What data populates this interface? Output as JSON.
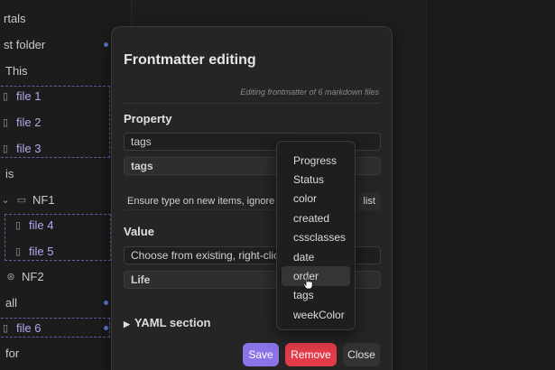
{
  "sidebar": {
    "rows": [
      {
        "label": "rtals",
        "type": "folder",
        "dot": false
      },
      {
        "label": "st folder",
        "type": "folder",
        "dot": true
      },
      {
        "label": "This",
        "type": "text",
        "dot": false
      },
      {
        "label": "file 1",
        "type": "file",
        "dot": false
      },
      {
        "label": "file 2",
        "type": "file",
        "dot": false
      },
      {
        "label": "file 3",
        "type": "file",
        "dot": false
      },
      {
        "label": "is",
        "type": "text",
        "dot": false
      },
      {
        "label": "NF1",
        "type": "folder",
        "dot": false
      },
      {
        "label": "file 4",
        "type": "file",
        "dot": false
      },
      {
        "label": "file 5",
        "type": "file",
        "dot": false
      },
      {
        "label": "NF2",
        "type": "folder",
        "dot": false
      },
      {
        "label": "all",
        "type": "text",
        "dot": true
      },
      {
        "label": "file 6",
        "type": "file",
        "dot": true
      },
      {
        "label": "for",
        "type": "text",
        "dot": false
      }
    ]
  },
  "modal": {
    "title": "Frontmatter editing",
    "subtitle": "Editing frontmatter of 6 markdown files",
    "property_heading": "Property",
    "property_input_value": "tags",
    "property_selected": "tags",
    "hint_text": "Ensure type on new items, ignore c",
    "hint_button": "list",
    "value_heading": "Value",
    "value_placeholder": "Choose from existing, right-clic",
    "value_current": "Life",
    "yaml_section": "YAML section",
    "save_label": "Save",
    "remove_label": "Remove",
    "close_label": "Close"
  },
  "dropdown": {
    "items": [
      "Progress",
      "Status",
      "color",
      "created",
      "cssclasses",
      "date",
      "order",
      "tags",
      "weekColor"
    ],
    "hovered_index": 6
  },
  "colors": {
    "accent": "#8b73e8",
    "danger": "#e23b4a",
    "dot": "#5b7fd4"
  }
}
